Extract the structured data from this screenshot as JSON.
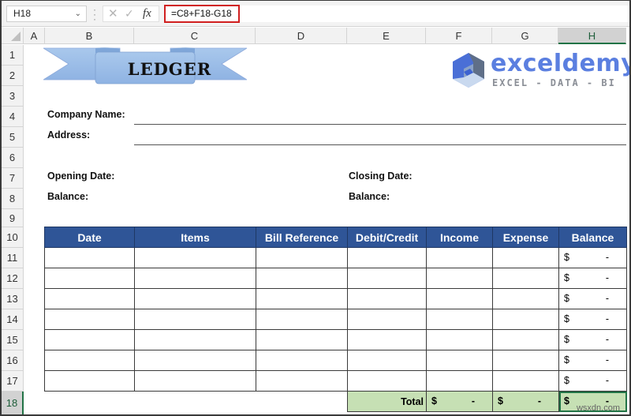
{
  "formula_bar": {
    "name_box": "H18",
    "formula": "=C8+F18-G18",
    "icons": [
      "chevron-down-icon",
      "cancel-icon",
      "enter-icon",
      "fx-icon"
    ],
    "cancel_glyph": "✕",
    "enter_glyph": "✓",
    "fx_label": "fx"
  },
  "columns": [
    "A",
    "B",
    "C",
    "D",
    "E",
    "F",
    "G",
    "H"
  ],
  "selected_column": "H",
  "rows": [
    "1",
    "2",
    "3",
    "4",
    "5",
    "6",
    "7",
    "8",
    "9",
    "10",
    "11",
    "12",
    "13",
    "14",
    "15",
    "16",
    "17",
    "18"
  ],
  "selected_row": "18",
  "banner": {
    "title": "LEDGER",
    "color": "#9dc3e6"
  },
  "logo": {
    "name": "exceldemy",
    "tagline": "EXCEL - DATA - BI",
    "color": "#5b7fe0"
  },
  "info": {
    "company_name_label": "Company Name:",
    "address_label": "Address:",
    "opening_date_label": "Opening Date:",
    "opening_balance_label": "Balance:",
    "closing_date_label": "Closing Date:",
    "closing_balance_label": "Balance:"
  },
  "table": {
    "header_color": "#2f5597",
    "total_color": "#c6e0b4",
    "headers": [
      "Date",
      "Items",
      "Bill Reference",
      "Debit/Credit",
      "Income",
      "Expense",
      "Balance"
    ],
    "rows": [
      {
        "date": "",
        "items": "",
        "bill_reference": "",
        "debit_credit": "",
        "income": "",
        "expense": "",
        "balance_currency": "$",
        "balance_value": "-"
      },
      {
        "date": "",
        "items": "",
        "bill_reference": "",
        "debit_credit": "",
        "income": "",
        "expense": "",
        "balance_currency": "$",
        "balance_value": "-"
      },
      {
        "date": "",
        "items": "",
        "bill_reference": "",
        "debit_credit": "",
        "income": "",
        "expense": "",
        "balance_currency": "$",
        "balance_value": "-"
      },
      {
        "date": "",
        "items": "",
        "bill_reference": "",
        "debit_credit": "",
        "income": "",
        "expense": "",
        "balance_currency": "$",
        "balance_value": "-"
      },
      {
        "date": "",
        "items": "",
        "bill_reference": "",
        "debit_credit": "",
        "income": "",
        "expense": "",
        "balance_currency": "$",
        "balance_value": "-"
      },
      {
        "date": "",
        "items": "",
        "bill_reference": "",
        "debit_credit": "",
        "income": "",
        "expense": "",
        "balance_currency": "$",
        "balance_value": "-"
      },
      {
        "date": "",
        "items": "",
        "bill_reference": "",
        "debit_credit": "",
        "income": "",
        "expense": "",
        "balance_currency": "$",
        "balance_value": "-"
      }
    ],
    "total": {
      "label": "Total",
      "income_currency": "$",
      "income_value": "-",
      "expense_currency": "$",
      "expense_value": "-",
      "balance_currency": "$",
      "balance_value": "-"
    }
  },
  "watermark": "wsxdn.com"
}
